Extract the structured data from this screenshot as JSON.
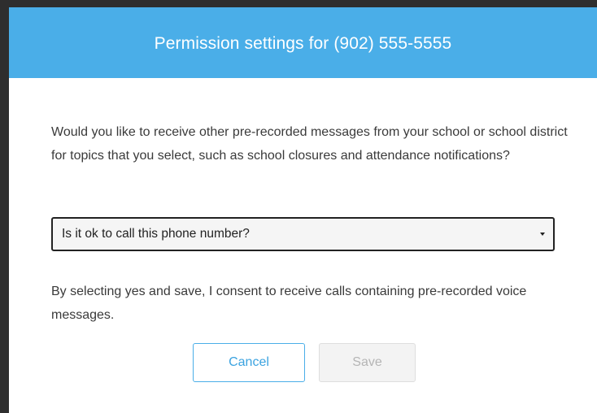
{
  "dialog": {
    "title": "Permission settings for (902) 555-5555",
    "intro": "Would you like to receive other pre-recorded messages from your school or school district for topics that you select, such as school closures and attendance notifications?",
    "select": {
      "selected": "Is it ok to call this phone number?",
      "icon": "caret-down-icon"
    },
    "consent": "By selecting yes and save, I consent to receive calls containing pre-recorded voice messages.",
    "buttons": {
      "cancel_label": "Cancel",
      "save_label": "Save"
    }
  },
  "colors": {
    "header": "#4aaee8",
    "cancel_border": "#4aaee8",
    "save_disabled_bg": "#f3f3f3",
    "text": "#3a3a3a"
  }
}
